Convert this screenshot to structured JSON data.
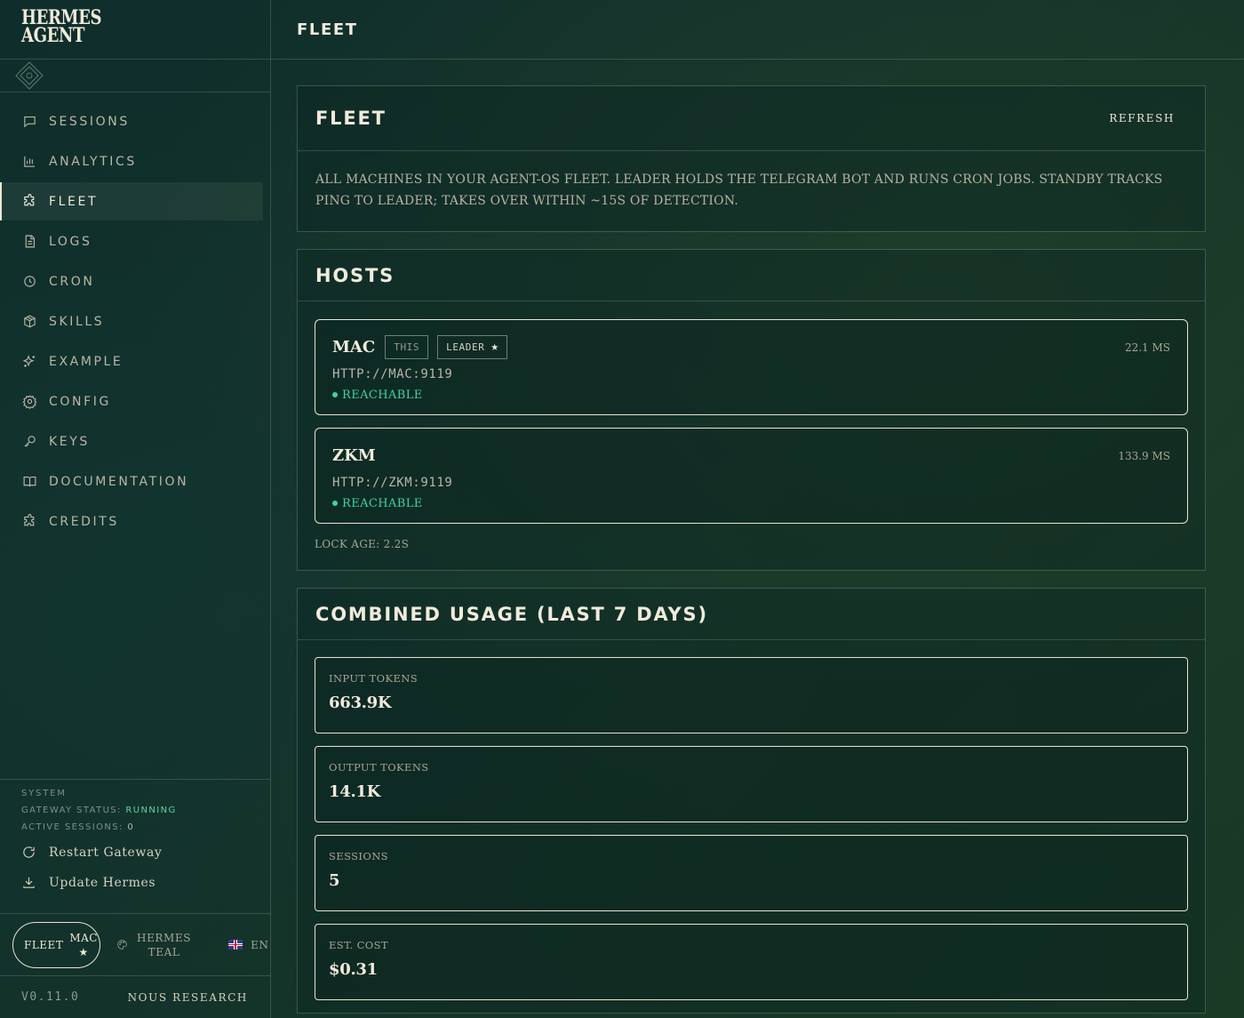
{
  "app": {
    "brand_line1": "HERMES",
    "brand_line2": "AGENT",
    "page_title": "FLEET"
  },
  "sidebar": {
    "items": [
      {
        "label": "SESSIONS",
        "icon": "chat-icon"
      },
      {
        "label": "ANALYTICS",
        "icon": "bar-chart-icon"
      },
      {
        "label": "FLEET",
        "icon": "puzzle-icon",
        "active": true
      },
      {
        "label": "LOGS",
        "icon": "file-text-icon"
      },
      {
        "label": "CRON",
        "icon": "clock-icon"
      },
      {
        "label": "SKILLS",
        "icon": "package-icon"
      },
      {
        "label": "EXAMPLE",
        "icon": "sparkles-icon"
      },
      {
        "label": "CONFIG",
        "icon": "gear-icon"
      },
      {
        "label": "KEYS",
        "icon": "key-icon"
      },
      {
        "label": "DOCUMENTATION",
        "icon": "book-icon"
      },
      {
        "label": "CREDITS",
        "icon": "puzzle-icon"
      }
    ],
    "system": {
      "title": "SYSTEM",
      "gateway_label": "GATEWAY STATUS:",
      "gateway_value": "RUNNING",
      "sessions_label": "ACTIVE SESSIONS:",
      "sessions_value": "0",
      "restart_label": "Restart Gateway",
      "update_label": "Update Hermes"
    },
    "footer": {
      "fleet_label": "FLEET",
      "fleet_host": "MAC",
      "fleet_star": "★",
      "theme_line1": "HERMES",
      "theme_line2": "TEAL",
      "lang_label": "EN",
      "version": "V0.11.0",
      "org": "NOUS RESEARCH"
    }
  },
  "fleet_card": {
    "title": "FLEET",
    "refresh_label": "REFRESH",
    "description": "ALL MACHINES IN YOUR AGENT-OS FLEET. LEADER HOLDS THE TELEGRAM BOT AND RUNS CRON JOBS. STANDBY TRACKS PING TO LEADER; TAKES OVER WITHIN ~15S OF DETECTION."
  },
  "hosts_card": {
    "title": "HOSTS",
    "hosts": [
      {
        "name": "MAC",
        "tag_this": "THIS",
        "tag_leader": "LEADER",
        "leader_star": "★",
        "latency": "22.1 MS",
        "url": "HTTP://MAC:9119",
        "status": "REACHABLE"
      },
      {
        "name": "ZKM",
        "latency": "133.9 MS",
        "url": "HTTP://ZKM:9119",
        "status": "REACHABLE"
      }
    ],
    "lock_age": "LOCK AGE: 2.2S"
  },
  "usage_card": {
    "title": "COMBINED USAGE (LAST 7 DAYS)",
    "metrics": [
      {
        "label": "INPUT TOKENS",
        "value": "663.9K"
      },
      {
        "label": "OUTPUT TOKENS",
        "value": "14.1K"
      },
      {
        "label": "SESSIONS",
        "value": "5"
      },
      {
        "label": "EST. COST",
        "value": "$0.31"
      }
    ]
  },
  "colors": {
    "accent": "#e8e4d6",
    "status_ok": "#3fd4a0",
    "background": "#0f2a26"
  }
}
